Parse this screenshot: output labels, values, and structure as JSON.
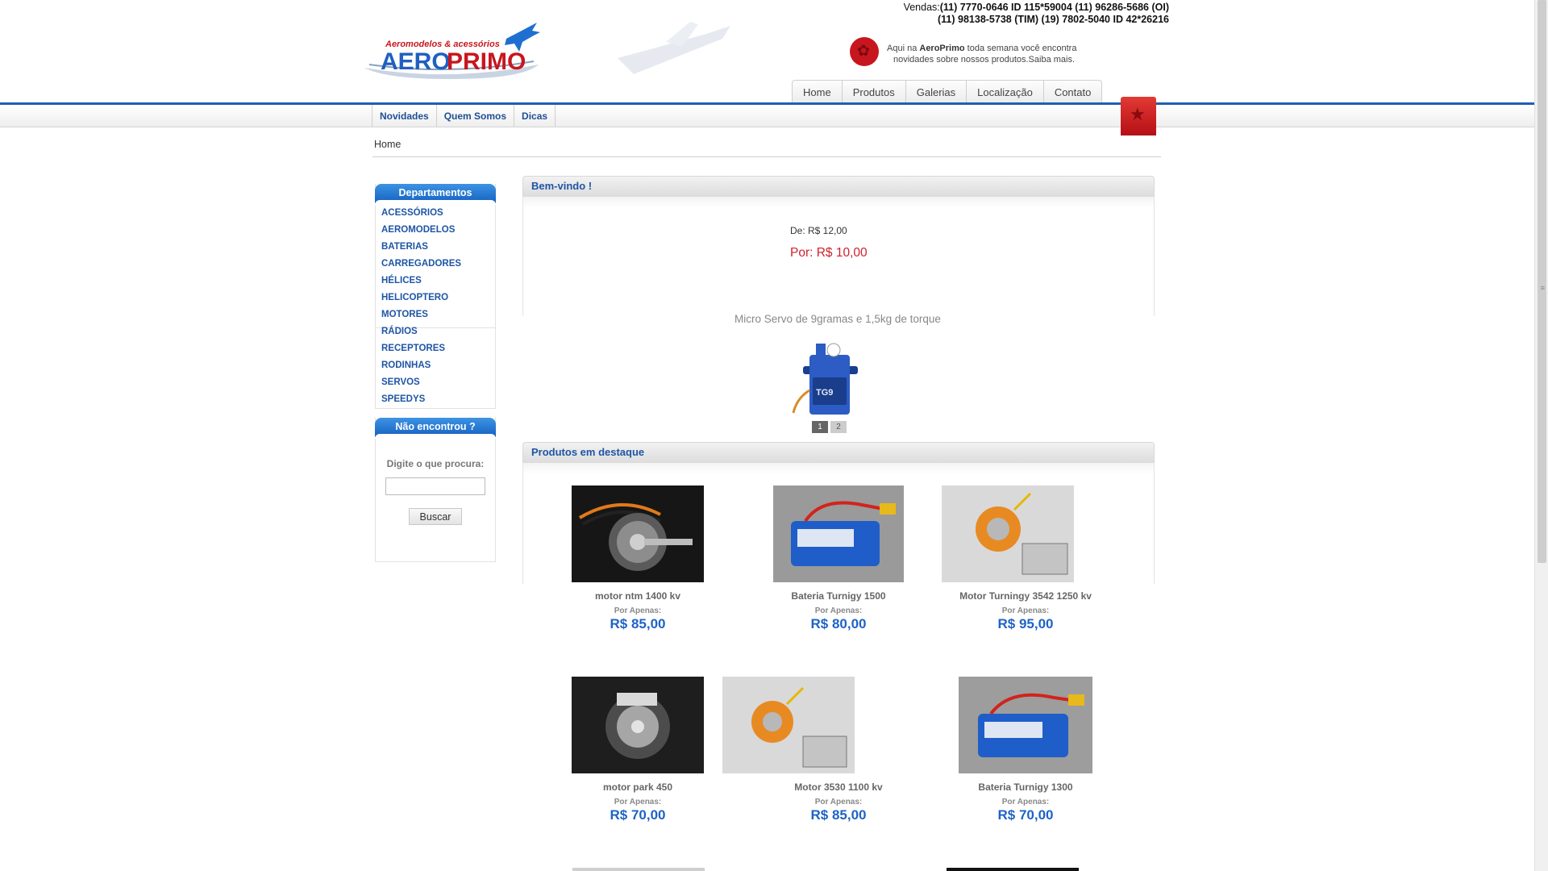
{
  "header": {
    "logo_tagline": "Aeromodelos & acessórios",
    "logo_name": "AEROPRIMO",
    "contacts_line1_prefix": "Vendas:",
    "contacts_line1": "(11) 7770-0646 ID 115*59004  (11) 96286-5686 (OI)",
    "contacts_line2": "(11) 98138-5738 (TIM)  (19) 7802-5040  ID 42*26216",
    "promo_line1_a": "Aqui na ",
    "promo_line1_b": "AeroPrimo",
    "promo_line1_c": " toda semana você encontra",
    "promo_line2": "novidades sobre nossos produtos.Saiba mais."
  },
  "top_nav": [
    "Home",
    "Produtos",
    "Galerias",
    "Localização",
    "Contato"
  ],
  "sub_nav": [
    "Novidades",
    "Quem Somos",
    "Dicas"
  ],
  "breadcrumb": "Home",
  "sidebar": {
    "departments_title": "Departamentos",
    "departments": [
      "ACESSÓRIOS",
      "AEROMODELOS",
      "BATERIAS",
      "CARREGADORES",
      "HÉLICES",
      "HELICOPTERO",
      "MOTORES",
      "RÁDIOS",
      "RECEPTORES",
      "RODINHAS",
      "SERVOS",
      "SPEEDYS"
    ],
    "search_title": "Não encontrou ?",
    "search_label": "Digite o que procura:",
    "search_value": "",
    "search_button": "Buscar"
  },
  "welcome": {
    "title": "Bem-vindo !",
    "price_old": "De: R$ 12,00",
    "price_new": "Por: R$ 10,00",
    "caption": "Micro Servo de 9gramas e 1,5kg de torque",
    "product_label": "TG9",
    "pages": [
      "1",
      "2"
    ],
    "active_page": 1
  },
  "featured": {
    "title": "Produtos em destaque",
    "price_prefix": "Por Apenas:",
    "products": [
      {
        "name": "motor ntm 1400 kv",
        "price": "R$ 85,00"
      },
      {
        "name": "Bateria Turnigy 1500",
        "price": "R$ 80,00"
      },
      {
        "name": "Motor Turningy 3542 1250 kv",
        "price": "R$ 95,00"
      },
      {
        "name": "motor park 450",
        "price": "R$ 70,00"
      },
      {
        "name": "Motor 3530 1100 kv",
        "price": "R$ 85,00"
      },
      {
        "name": "Bateria Turnigy 1300",
        "price": "R$ 70,00"
      }
    ]
  },
  "colors": {
    "brand_blue": "#1e5fb2",
    "link_blue": "#1e55a5",
    "price_blue": "#1e63c6",
    "sale_red": "#d0202b"
  }
}
